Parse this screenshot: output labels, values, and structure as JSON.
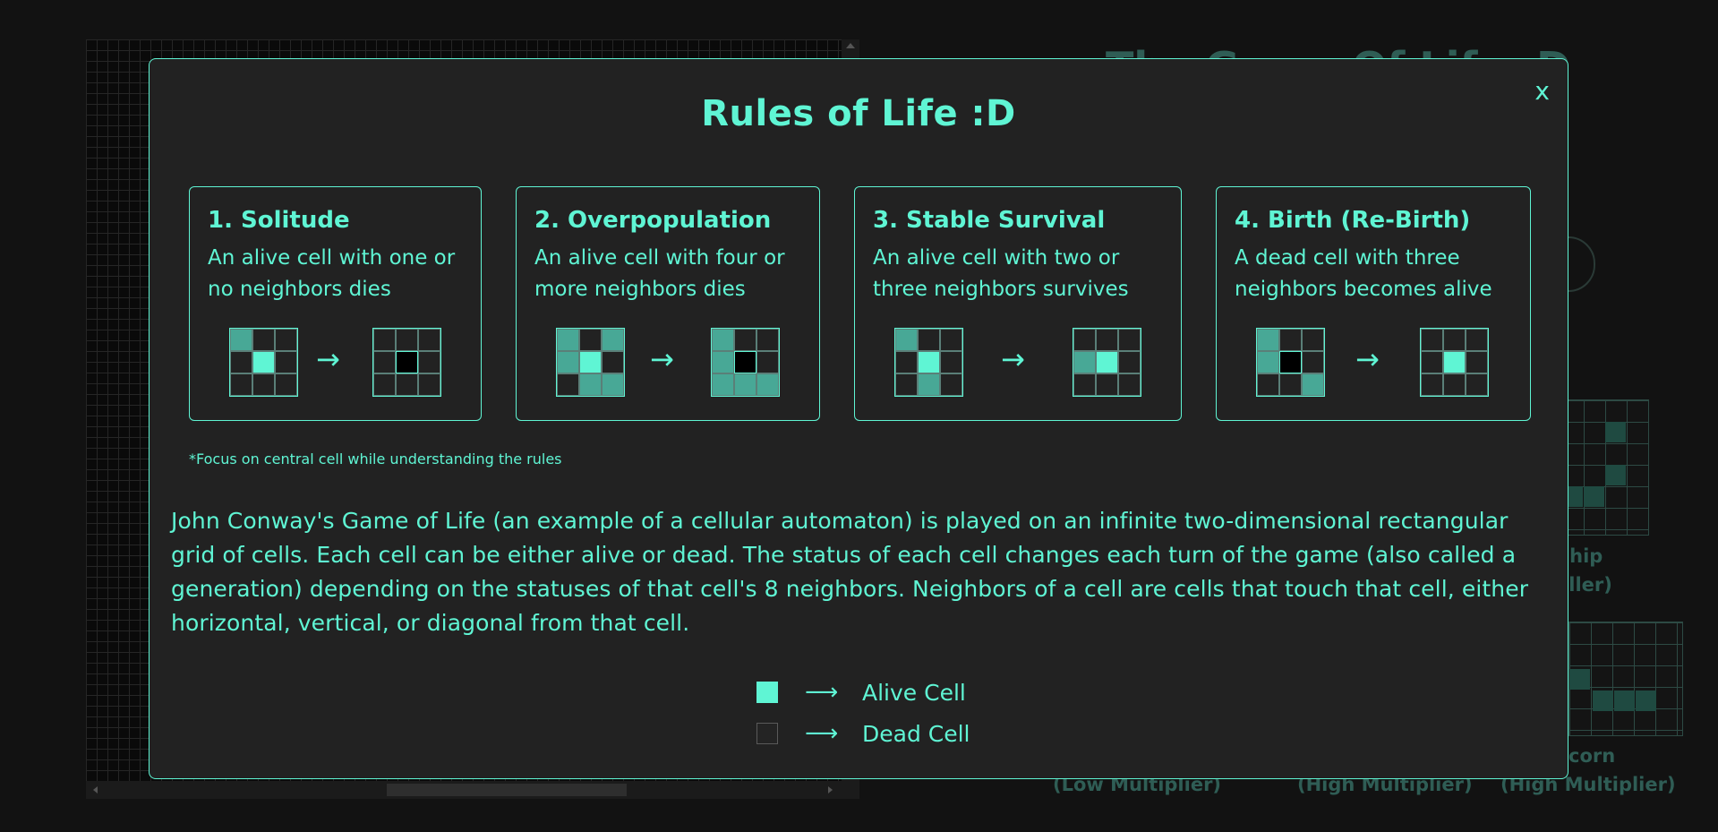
{
  "background": {
    "title": "The Game Of Life :D",
    "captions": [
      "Ship",
      "eller)",
      "corn",
      "(Low Multiplier)",
      "(High Multiplier)",
      "(High Multiplier)"
    ]
  },
  "modal": {
    "title": "Rules of Life :D",
    "close_label": "x",
    "rules": [
      {
        "title": "1. Solitude",
        "desc": "An alive cell with one or no neighbors dies",
        "before": [
          "n",
          "0",
          "0",
          "0",
          "a",
          "0",
          "0",
          "0",
          "0"
        ],
        "after": [
          "0",
          "0",
          "0",
          "0",
          "d",
          "0",
          "0",
          "0",
          "0"
        ]
      },
      {
        "title": "2. Overpopulation",
        "desc": "An alive cell with four or more neighbors dies",
        "before": [
          "n",
          "0",
          "n",
          "n",
          "a",
          "0",
          "0",
          "n",
          "n"
        ],
        "after": [
          "n",
          "0",
          "0",
          "n",
          "d",
          "0",
          "n",
          "n",
          "n"
        ]
      },
      {
        "title": "3. Stable Survival",
        "desc": "An alive cell with two or three neighbors survives",
        "before": [
          "n",
          "0",
          "0",
          "0",
          "a",
          "0",
          "0",
          "n",
          "0"
        ],
        "after": [
          "0",
          "0",
          "0",
          "n",
          "a",
          "0",
          "0",
          "0",
          "0"
        ]
      },
      {
        "title": "4. Birth (Re-Birth)",
        "desc": "A dead cell with three neighbors becomes alive",
        "before": [
          "n",
          "0",
          "0",
          "n",
          "d",
          "0",
          "0",
          "0",
          "n"
        ],
        "after": [
          "0",
          "0",
          "0",
          "0",
          "a",
          "0",
          "0",
          "0",
          "0"
        ]
      }
    ],
    "arrow": "→",
    "footnote": "*Focus on central cell while understanding the rules",
    "description": "John Conway's Game of Life (an example of a cellular automaton) is played on an infinite two-dimensional rectangular grid of cells. Each cell can be either alive or dead. The status of each cell changes each turn of the game (also called a generation) depending on the statuses of that cell's 8 neighbors. Neighbors of a cell are cells that touch that cell, either horizontal, vertical, or diagonal from that cell.",
    "legend": {
      "arrow": "⟶",
      "alive_label": "Alive Cell",
      "dead_label": "Dead Cell"
    }
  },
  "colors": {
    "accent": "#5ff5d4",
    "neighbor": "#48a896",
    "modal_bg": "#222222",
    "page_bg": "#121212"
  }
}
